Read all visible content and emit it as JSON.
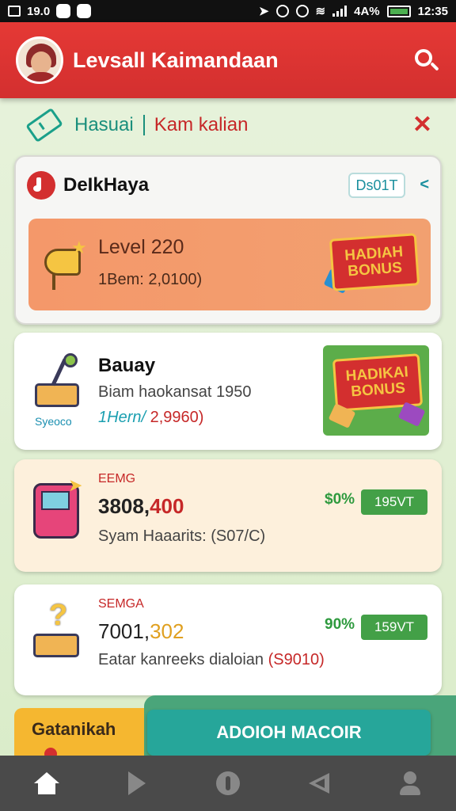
{
  "status_bar": {
    "time_left": "19.0",
    "battery_pct": "4A%",
    "time_right": "12:35"
  },
  "header": {
    "title": "Levsall Kaimandaan"
  },
  "tabs": {
    "tab_a": "Hasuai",
    "tab_b": "Kam kalian"
  },
  "card1": {
    "title": "DeIkHaya",
    "pill_label": "Ds01T",
    "banner": {
      "title": "Level 220",
      "subtitle": "1Bem: 2,0100)",
      "bonus_line1": "HADIAH",
      "bonus_line2": "BONUS"
    }
  },
  "card2": {
    "caption": "Syeoco",
    "title": "Bauay",
    "desc": "Biam haokansat 1950",
    "price_a": "1Hern/ ",
    "price_b": "2,9960)",
    "bonus_line1": "HADIKAI",
    "bonus_line2": "BONUS"
  },
  "card3": {
    "label": "EEMG",
    "amount_a": "3808,",
    "amount_b": "400",
    "desc": "Syam Haaarits: (S07/C)",
    "pct": "$0%",
    "button": "195VT"
  },
  "card4": {
    "label": "SEMGA",
    "amount_a": "7001,",
    "amount_b": "302",
    "desc_a": "Eatar kanreeks dialoian ",
    "desc_b": "(S9010)",
    "pct": "90%",
    "button": "159VT"
  },
  "bottom": {
    "left_label": "Gatanikah",
    "action_label": "ADOIOH MACOIR"
  },
  "colors": {
    "header_red": "#d32f2f",
    "accent_teal": "#26a69a",
    "accent_green": "#43a047",
    "accent_orange": "#f4986a"
  }
}
